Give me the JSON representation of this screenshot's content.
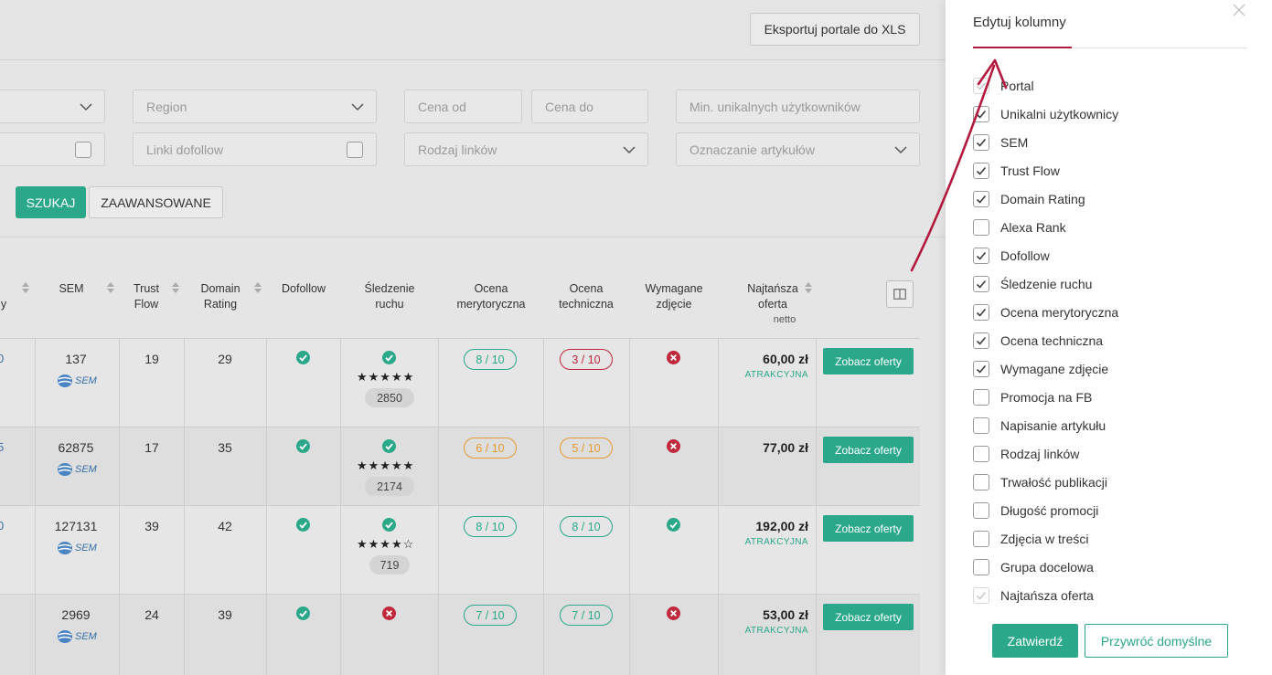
{
  "toolbar": {
    "export_label": "Eksportuj portale do XLS"
  },
  "filters": {
    "region_placeholder": "Region",
    "price_from_placeholder": "Cena od",
    "price_to_placeholder": "Cena do",
    "min_users_placeholder": "Min. unikalnych użytkowników",
    "dofollow_links_label": "Linki dofollow",
    "link_type_placeholder": "Rodzaj linków",
    "article_marking_placeholder": "Oznaczanie artykułów",
    "search_label": "SZUKAJ",
    "advanced_label": "ZAAWANSOWANE"
  },
  "table": {
    "headers": {
      "partial": "y",
      "sem": "SEM",
      "trust_flow": [
        "Trust",
        "Flow"
      ],
      "domain_rating": [
        "Domain",
        "Rating"
      ],
      "dofollow": "Dofollow",
      "traffic": [
        "Śledzenie",
        "ruchu"
      ],
      "merit": [
        "Ocena",
        "merytoryczna"
      ],
      "technical": [
        "Ocena",
        "techniczna"
      ],
      "photo": [
        "Wymagane",
        "zdjęcie"
      ],
      "cheapest": [
        "Najtańsza",
        "oferta"
      ],
      "cheapest_sub": "netto"
    },
    "rows": [
      {
        "edge": "0",
        "sem": "137",
        "sem_logo": "SEM",
        "trust_flow": "19",
        "domain_rating": "29",
        "dofollow": "check",
        "traffic_icon": "check",
        "stars": "★★★★★",
        "traffic_count": "2850",
        "merit": "8 / 10",
        "merit_color": "green",
        "technical": "3 / 10",
        "technical_color": "red",
        "photo": "cross",
        "price": "60,00 zł",
        "tag": "ATRAKCYJNA",
        "offer_label": "Zobacz oferty"
      },
      {
        "edge": "5",
        "sem": "62875",
        "sem_logo": "SEM",
        "trust_flow": "17",
        "domain_rating": "35",
        "dofollow": "check",
        "traffic_icon": "check",
        "stars": "★★★★★",
        "traffic_count": "2174",
        "merit": "6 / 10",
        "merit_color": "orange",
        "technical": "5 / 10",
        "technical_color": "orange",
        "photo": "cross",
        "price": "77,00 zł",
        "tag": "",
        "offer_label": "Zobacz oferty"
      },
      {
        "edge": "0",
        "sem": "127131",
        "sem_logo": "SEM",
        "trust_flow": "39",
        "domain_rating": "42",
        "dofollow": "check",
        "traffic_icon": "check",
        "stars": "★★★★☆",
        "traffic_count": "719",
        "merit": "8 / 10",
        "merit_color": "green",
        "technical": "8 / 10",
        "technical_color": "green",
        "photo": "check",
        "price": "192,00 zł",
        "tag": "ATRAKCYJNA",
        "offer_label": "Zobacz oferty"
      },
      {
        "edge": "",
        "sem": "2969",
        "sem_logo": "SEM",
        "trust_flow": "24",
        "domain_rating": "39",
        "dofollow": "check",
        "traffic_icon": "cross",
        "stars": "",
        "traffic_count": "",
        "merit": "7 / 10",
        "merit_color": "green",
        "technical": "7 / 10",
        "technical_color": "green",
        "photo": "cross",
        "price": "53,00 zł",
        "tag": "ATRAKCYJNA",
        "offer_label": "Zobacz oferty"
      }
    ]
  },
  "panel": {
    "title": "Edytuj kolumny",
    "options": [
      {
        "label": "Portal",
        "checked": true,
        "disabled": true
      },
      {
        "label": "Unikalni użytkownicy",
        "checked": true,
        "disabled": false
      },
      {
        "label": "SEM",
        "checked": true,
        "disabled": false
      },
      {
        "label": "Trust Flow",
        "checked": true,
        "disabled": false
      },
      {
        "label": "Domain Rating",
        "checked": true,
        "disabled": false
      },
      {
        "label": "Alexa Rank",
        "checked": false,
        "disabled": false
      },
      {
        "label": "Dofollow",
        "checked": true,
        "disabled": false
      },
      {
        "label": "Śledzenie ruchu",
        "checked": true,
        "disabled": false
      },
      {
        "label": "Ocena merytoryczna",
        "checked": true,
        "disabled": false
      },
      {
        "label": "Ocena techniczna",
        "checked": true,
        "disabled": false
      },
      {
        "label": "Wymagane zdjęcie",
        "checked": true,
        "disabled": false
      },
      {
        "label": "Promocja na FB",
        "checked": false,
        "disabled": false
      },
      {
        "label": "Napisanie artykułu",
        "checked": false,
        "disabled": false
      },
      {
        "label": "Rodzaj linków",
        "checked": false,
        "disabled": false
      },
      {
        "label": "Trwałość publikacji",
        "checked": false,
        "disabled": false
      },
      {
        "label": "Długość promocji",
        "checked": false,
        "disabled": false
      },
      {
        "label": "Zdjęcia w treści",
        "checked": false,
        "disabled": false
      },
      {
        "label": "Grupa docelowa",
        "checked": false,
        "disabled": false
      },
      {
        "label": "Najtańsza oferta",
        "checked": true,
        "disabled": true
      }
    ],
    "confirm_label": "Zatwierdź",
    "reset_label": "Przywróć domyślne"
  },
  "colors": {
    "accent": "#2aa889",
    "annotation": "#b3193d",
    "danger": "#c0283c",
    "warning": "#e89a2e"
  }
}
